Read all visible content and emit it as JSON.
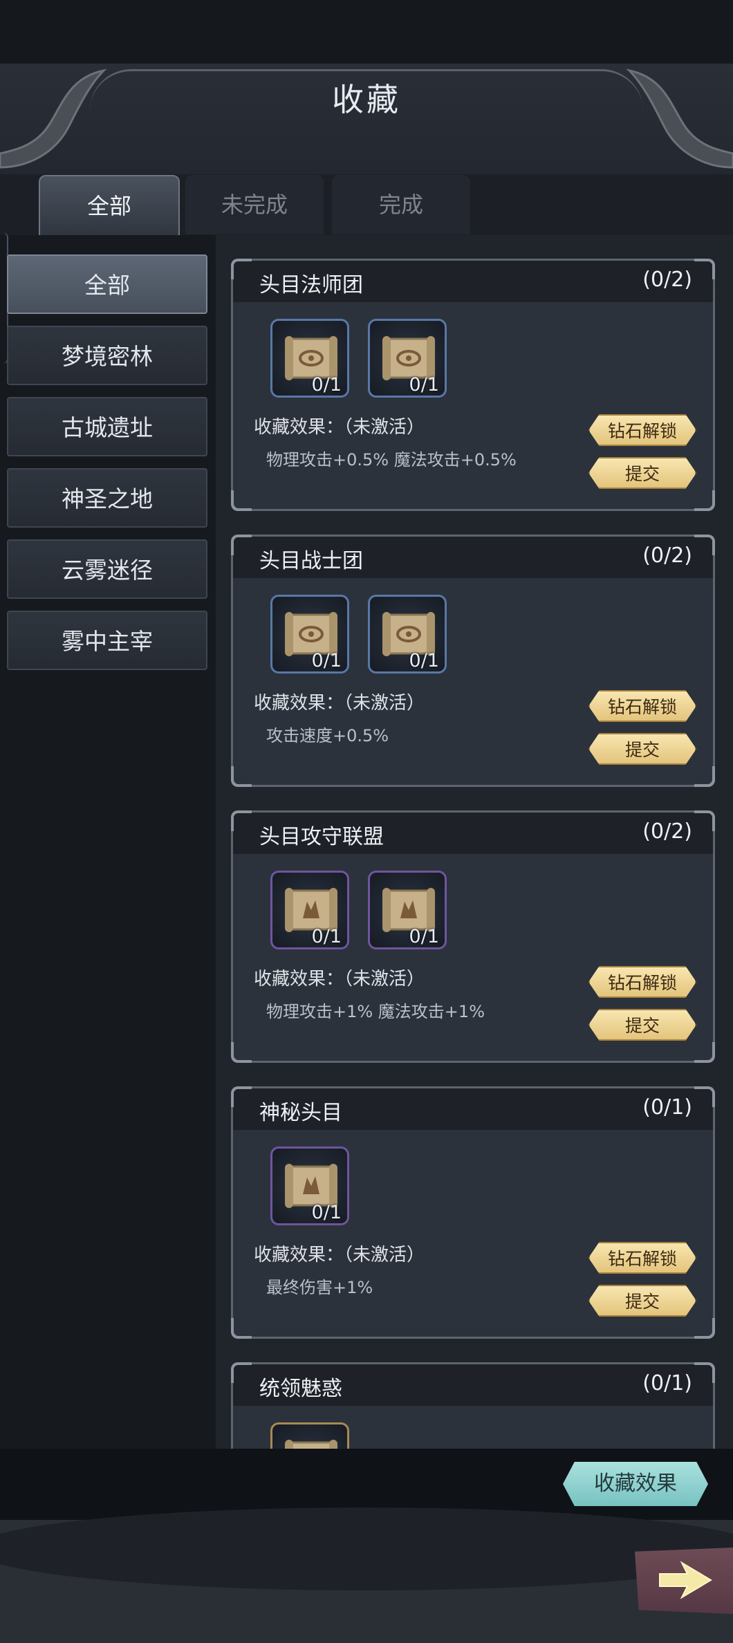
{
  "header": {
    "title": "收藏"
  },
  "tabs": [
    {
      "label": "全部"
    },
    {
      "label": "未完成"
    },
    {
      "label": "完成"
    }
  ],
  "sidebar": {
    "items": [
      {
        "label": "全部"
      },
      {
        "label": "梦境密林"
      },
      {
        "label": "古城遗址"
      },
      {
        "label": "神圣之地"
      },
      {
        "label": "云雾迷径"
      },
      {
        "label": "雾中主宰"
      }
    ]
  },
  "cards": [
    {
      "title": "头目法师团",
      "count": "(0/2)",
      "items": [
        {
          "count": "0/1",
          "rarity": "blue"
        },
        {
          "count": "0/1",
          "rarity": "blue"
        }
      ],
      "effect_label": "收藏效果：（未激活）",
      "effect_value": "物理攻击+0.5%  魔法攻击+0.5%",
      "unlock_label": "钻石解锁",
      "submit_label": "提交"
    },
    {
      "title": "头目战士团",
      "count": "(0/2)",
      "items": [
        {
          "count": "0/1",
          "rarity": "blue"
        },
        {
          "count": "0/1",
          "rarity": "blue"
        }
      ],
      "effect_label": "收藏效果：（未激活）",
      "effect_value": "攻击速度+0.5%",
      "unlock_label": "钻石解锁",
      "submit_label": "提交"
    },
    {
      "title": "头目攻守联盟",
      "count": "(0/2)",
      "items": [
        {
          "count": "0/1",
          "rarity": "purple"
        },
        {
          "count": "0/1",
          "rarity": "purple"
        }
      ],
      "effect_label": "收藏效果：（未激活）",
      "effect_value": "物理攻击+1%  魔法攻击+1%",
      "unlock_label": "钻石解锁",
      "submit_label": "提交"
    },
    {
      "title": "神秘头目",
      "count": "(0/1)",
      "items": [
        {
          "count": "0/1",
          "rarity": "purple"
        }
      ],
      "effect_label": "收藏效果：（未激活）",
      "effect_value": "最终伤害+1%",
      "unlock_label": "钻石解锁",
      "submit_label": "提交"
    },
    {
      "title": "统领魅惑",
      "count": "(0/1)",
      "items": [
        {
          "rarity": "gold"
        }
      ]
    }
  ],
  "footer": {
    "effects_button": "收藏效果"
  },
  "icons": {
    "horn": "ornament-horn-icon",
    "scroll": "scroll-icon",
    "next": "arrow-right-icon"
  },
  "colors": {
    "gold_button": "#e3c47c",
    "teal_button": "#78c2c2",
    "blue_rarity": "#5978a8",
    "purple_rarity": "#6f55a0",
    "gold_rarity": "#a68a56"
  }
}
